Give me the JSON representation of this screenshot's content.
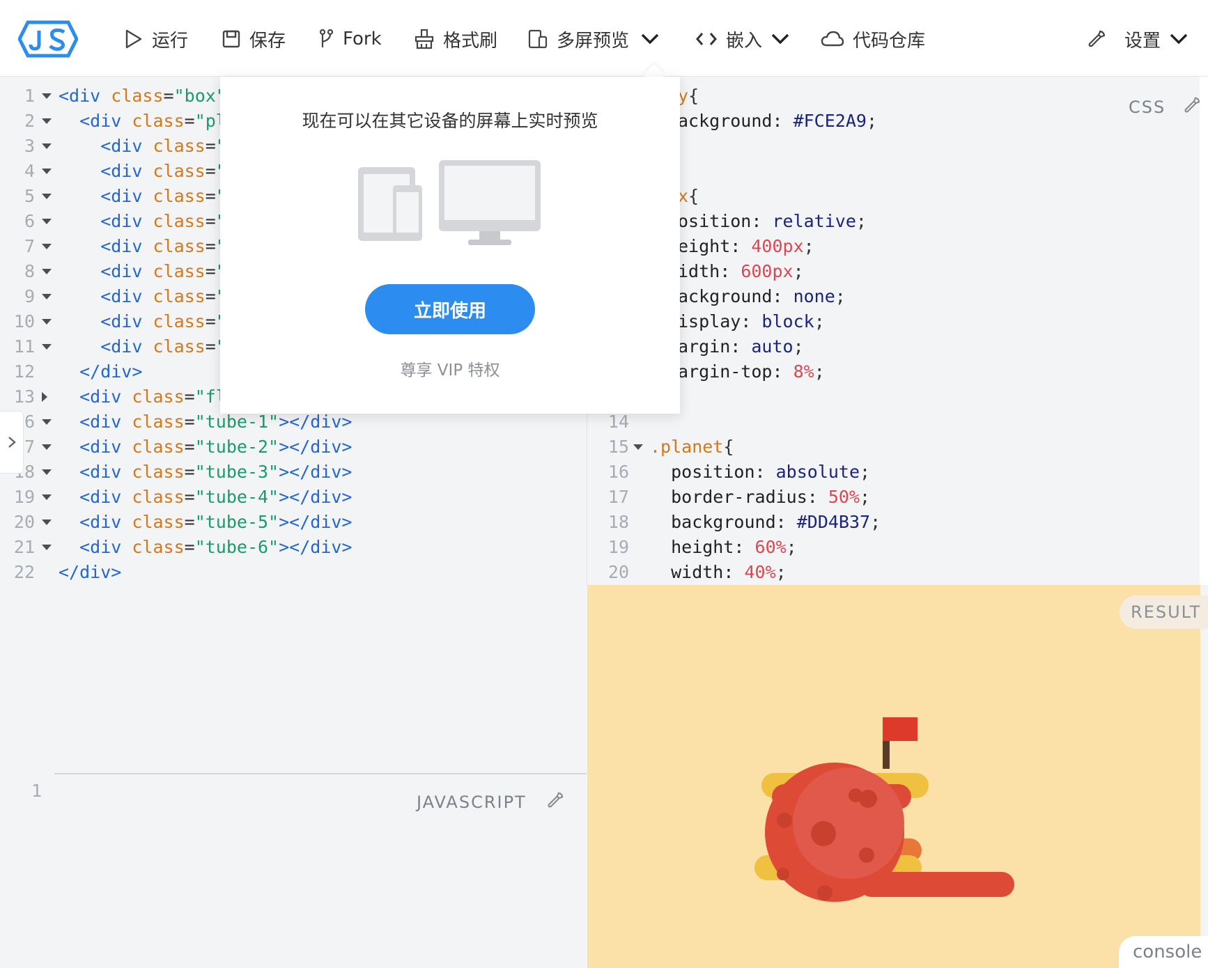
{
  "toolbar": {
    "run": "运行",
    "save": "保存",
    "fork": "Fork",
    "format": "格式刷",
    "multiscreen": "多屏预览",
    "embed": "嵌入",
    "repo": "代码仓库",
    "settings": "设置"
  },
  "html_editor": {
    "gutter": [
      "1",
      "2",
      "3",
      "4",
      "5",
      "6",
      "7",
      "8",
      "9",
      "10",
      "11",
      "12",
      "13",
      "6",
      "7",
      "18",
      "19",
      "20",
      "21",
      "22"
    ],
    "lines": [
      [
        [
          "tag",
          "<div "
        ],
        [
          "attr",
          "class"
        ],
        [
          "punct",
          "="
        ],
        [
          "str",
          "\"box\""
        ],
        [
          "tag",
          ">"
        ]
      ],
      [
        [
          "tag",
          "  <div "
        ],
        [
          "attr",
          "class"
        ],
        [
          "punct",
          "="
        ],
        [
          "str",
          "\"pl"
        ]
      ],
      [
        [
          "tag",
          "    <div "
        ],
        [
          "attr",
          "class"
        ],
        [
          "punct",
          "="
        ],
        [
          "str",
          "\""
        ]
      ],
      [
        [
          "tag",
          "    <div "
        ],
        [
          "attr",
          "class"
        ],
        [
          "punct",
          "="
        ],
        [
          "str",
          "\""
        ]
      ],
      [
        [
          "tag",
          "    <div "
        ],
        [
          "attr",
          "class"
        ],
        [
          "punct",
          "="
        ],
        [
          "str",
          "\""
        ]
      ],
      [
        [
          "tag",
          "    <div "
        ],
        [
          "attr",
          "class"
        ],
        [
          "punct",
          "="
        ],
        [
          "str",
          "\""
        ]
      ],
      [
        [
          "tag",
          "    <div "
        ],
        [
          "attr",
          "class"
        ],
        [
          "punct",
          "="
        ],
        [
          "str",
          "\""
        ]
      ],
      [
        [
          "tag",
          "    <div "
        ],
        [
          "attr",
          "class"
        ],
        [
          "punct",
          "="
        ],
        [
          "str",
          "\""
        ]
      ],
      [
        [
          "tag",
          "    <div "
        ],
        [
          "attr",
          "class"
        ],
        [
          "punct",
          "="
        ],
        [
          "str",
          "\""
        ]
      ],
      [
        [
          "tag",
          "    <div "
        ],
        [
          "attr",
          "class"
        ],
        [
          "punct",
          "="
        ],
        [
          "str",
          "\""
        ]
      ],
      [
        [
          "tag",
          "    <div "
        ],
        [
          "attr",
          "class"
        ],
        [
          "punct",
          "="
        ],
        [
          "str",
          "\""
        ]
      ],
      [
        [
          "tag",
          "  </div>"
        ]
      ],
      [
        [
          "tag",
          "  <div "
        ],
        [
          "attr",
          "class"
        ],
        [
          "punct",
          "="
        ],
        [
          "str",
          "\"fl"
        ]
      ],
      [
        [
          "tag",
          "  <div "
        ],
        [
          "attr",
          "class"
        ],
        [
          "punct",
          "="
        ],
        [
          "str",
          "\"tube-1\""
        ],
        [
          "tag",
          "></div>"
        ]
      ],
      [
        [
          "tag",
          "  <div "
        ],
        [
          "attr",
          "class"
        ],
        [
          "punct",
          "="
        ],
        [
          "str",
          "\"tube-2\""
        ],
        [
          "tag",
          "></div>"
        ]
      ],
      [
        [
          "tag",
          "  <div "
        ],
        [
          "attr",
          "class"
        ],
        [
          "punct",
          "="
        ],
        [
          "str",
          "\"tube-3\""
        ],
        [
          "tag",
          "></div>"
        ]
      ],
      [
        [
          "tag",
          "  <div "
        ],
        [
          "attr",
          "class"
        ],
        [
          "punct",
          "="
        ],
        [
          "str",
          "\"tube-4\""
        ],
        [
          "tag",
          "></div>"
        ]
      ],
      [
        [
          "tag",
          "  <div "
        ],
        [
          "attr",
          "class"
        ],
        [
          "punct",
          "="
        ],
        [
          "str",
          "\"tube-5\""
        ],
        [
          "tag",
          "></div>"
        ]
      ],
      [
        [
          "tag",
          "  <div "
        ],
        [
          "attr",
          "class"
        ],
        [
          "punct",
          "="
        ],
        [
          "str",
          "\"tube-6\""
        ],
        [
          "tag",
          "></div>"
        ]
      ],
      [
        [
          "tag",
          "</div>"
        ]
      ]
    ]
  },
  "css_editor": {
    "label": "CSS",
    "lines": [
      [
        [
          "sel",
          "y"
        ],
        [
          "punct",
          "{"
        ]
      ],
      [
        [
          "prop",
          "ackground: "
        ],
        [
          "hex",
          "#FCE2A9"
        ],
        [
          "punct",
          ";"
        ]
      ],
      [],
      [],
      [
        [
          "sel",
          "x"
        ],
        [
          "punct",
          "{"
        ]
      ],
      [
        [
          "prop",
          "osition: "
        ],
        [
          "kw",
          "relative"
        ],
        [
          "punct",
          ";"
        ]
      ],
      [
        [
          "prop",
          "eight: "
        ],
        [
          "num",
          "400px"
        ],
        [
          "punct",
          ";"
        ]
      ],
      [
        [
          "prop",
          "idth: "
        ],
        [
          "num",
          "600px"
        ],
        [
          "punct",
          ";"
        ]
      ],
      [
        [
          "prop",
          "ackground: "
        ],
        [
          "kw",
          "none"
        ],
        [
          "punct",
          ";"
        ]
      ],
      [
        [
          "prop",
          "isplay: "
        ],
        [
          "kw",
          "block"
        ],
        [
          "punct",
          ";"
        ]
      ],
      [
        [
          "prop",
          "argin: "
        ],
        [
          "kw",
          "auto"
        ],
        [
          "punct",
          ";"
        ]
      ],
      [
        [
          "prop",
          "argin-top: "
        ],
        [
          "num",
          "8%"
        ],
        [
          "punct",
          ";"
        ]
      ]
    ],
    "gutter_lower": [
      "14",
      "15",
      "16",
      "17",
      "18",
      "19",
      "20"
    ],
    "lines_lower": [
      [],
      [
        [
          "sel",
          ".planet"
        ],
        [
          "punct",
          "{"
        ]
      ],
      [
        [
          "prop",
          "  position: "
        ],
        [
          "kw",
          "absolute"
        ],
        [
          "punct",
          ";"
        ]
      ],
      [
        [
          "prop",
          "  border-radius: "
        ],
        [
          "num",
          "50%"
        ],
        [
          "punct",
          ";"
        ]
      ],
      [
        [
          "prop",
          "  background: "
        ],
        [
          "hex",
          "#DD4B37"
        ],
        [
          "punct",
          ";"
        ]
      ],
      [
        [
          "prop",
          "  height: "
        ],
        [
          "num",
          "60%"
        ],
        [
          "punct",
          ";"
        ]
      ],
      [
        [
          "prop",
          "  width: "
        ],
        [
          "num",
          "40%"
        ],
        [
          "punct",
          ";"
        ]
      ]
    ]
  },
  "js_editor": {
    "label": "JAVASCRIPT",
    "gutter": [
      "1"
    ]
  },
  "result": {
    "label": "RESULT",
    "console": "console"
  },
  "popup": {
    "title": "现在可以在其它设备的屏幕上实时预览",
    "button": "立即使用",
    "sub": "尊享 VIP 特权"
  },
  "colors": {
    "accent": "#2d8cf0",
    "result_bg": "#fbe0a8",
    "planet": "#DD4B37"
  }
}
